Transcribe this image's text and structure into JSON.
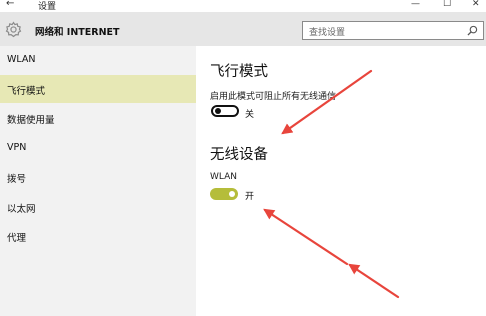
{
  "window": {
    "back_glyph": "←",
    "title": "设置",
    "minimize_glyph": "—",
    "maximize_glyph": "☐",
    "close_glyph": "✕"
  },
  "header": {
    "title": "网络和 INTERNET",
    "icon": "gear-icon",
    "search_placeholder": "查找设置",
    "search_icon": "search-icon"
  },
  "sidebar": {
    "items": [
      {
        "label": "WLAN",
        "active": false
      },
      {
        "label": "飞行模式",
        "active": true
      },
      {
        "label": "数据使用量",
        "active": false
      },
      {
        "label": "VPN",
        "active": false
      },
      {
        "label": "拨号",
        "active": false
      },
      {
        "label": "以太网",
        "active": false
      },
      {
        "label": "代理",
        "active": false
      }
    ]
  },
  "main": {
    "airplane": {
      "title": "飞行模式",
      "description": "启用此模式可阻止所有无线通信",
      "toggle_state": "off",
      "toggle_label": "关"
    },
    "wireless": {
      "title": "无线设备",
      "wlan_label": "WLAN",
      "toggle_state": "on",
      "toggle_label": "开"
    }
  },
  "colors": {
    "accent": "#b5bd3a",
    "sidebar_active": "#e7e8b5",
    "header_bg": "#e6e6e6",
    "sidebar_bg": "#f2f2f2",
    "annotation_arrow": "#e8453c"
  }
}
